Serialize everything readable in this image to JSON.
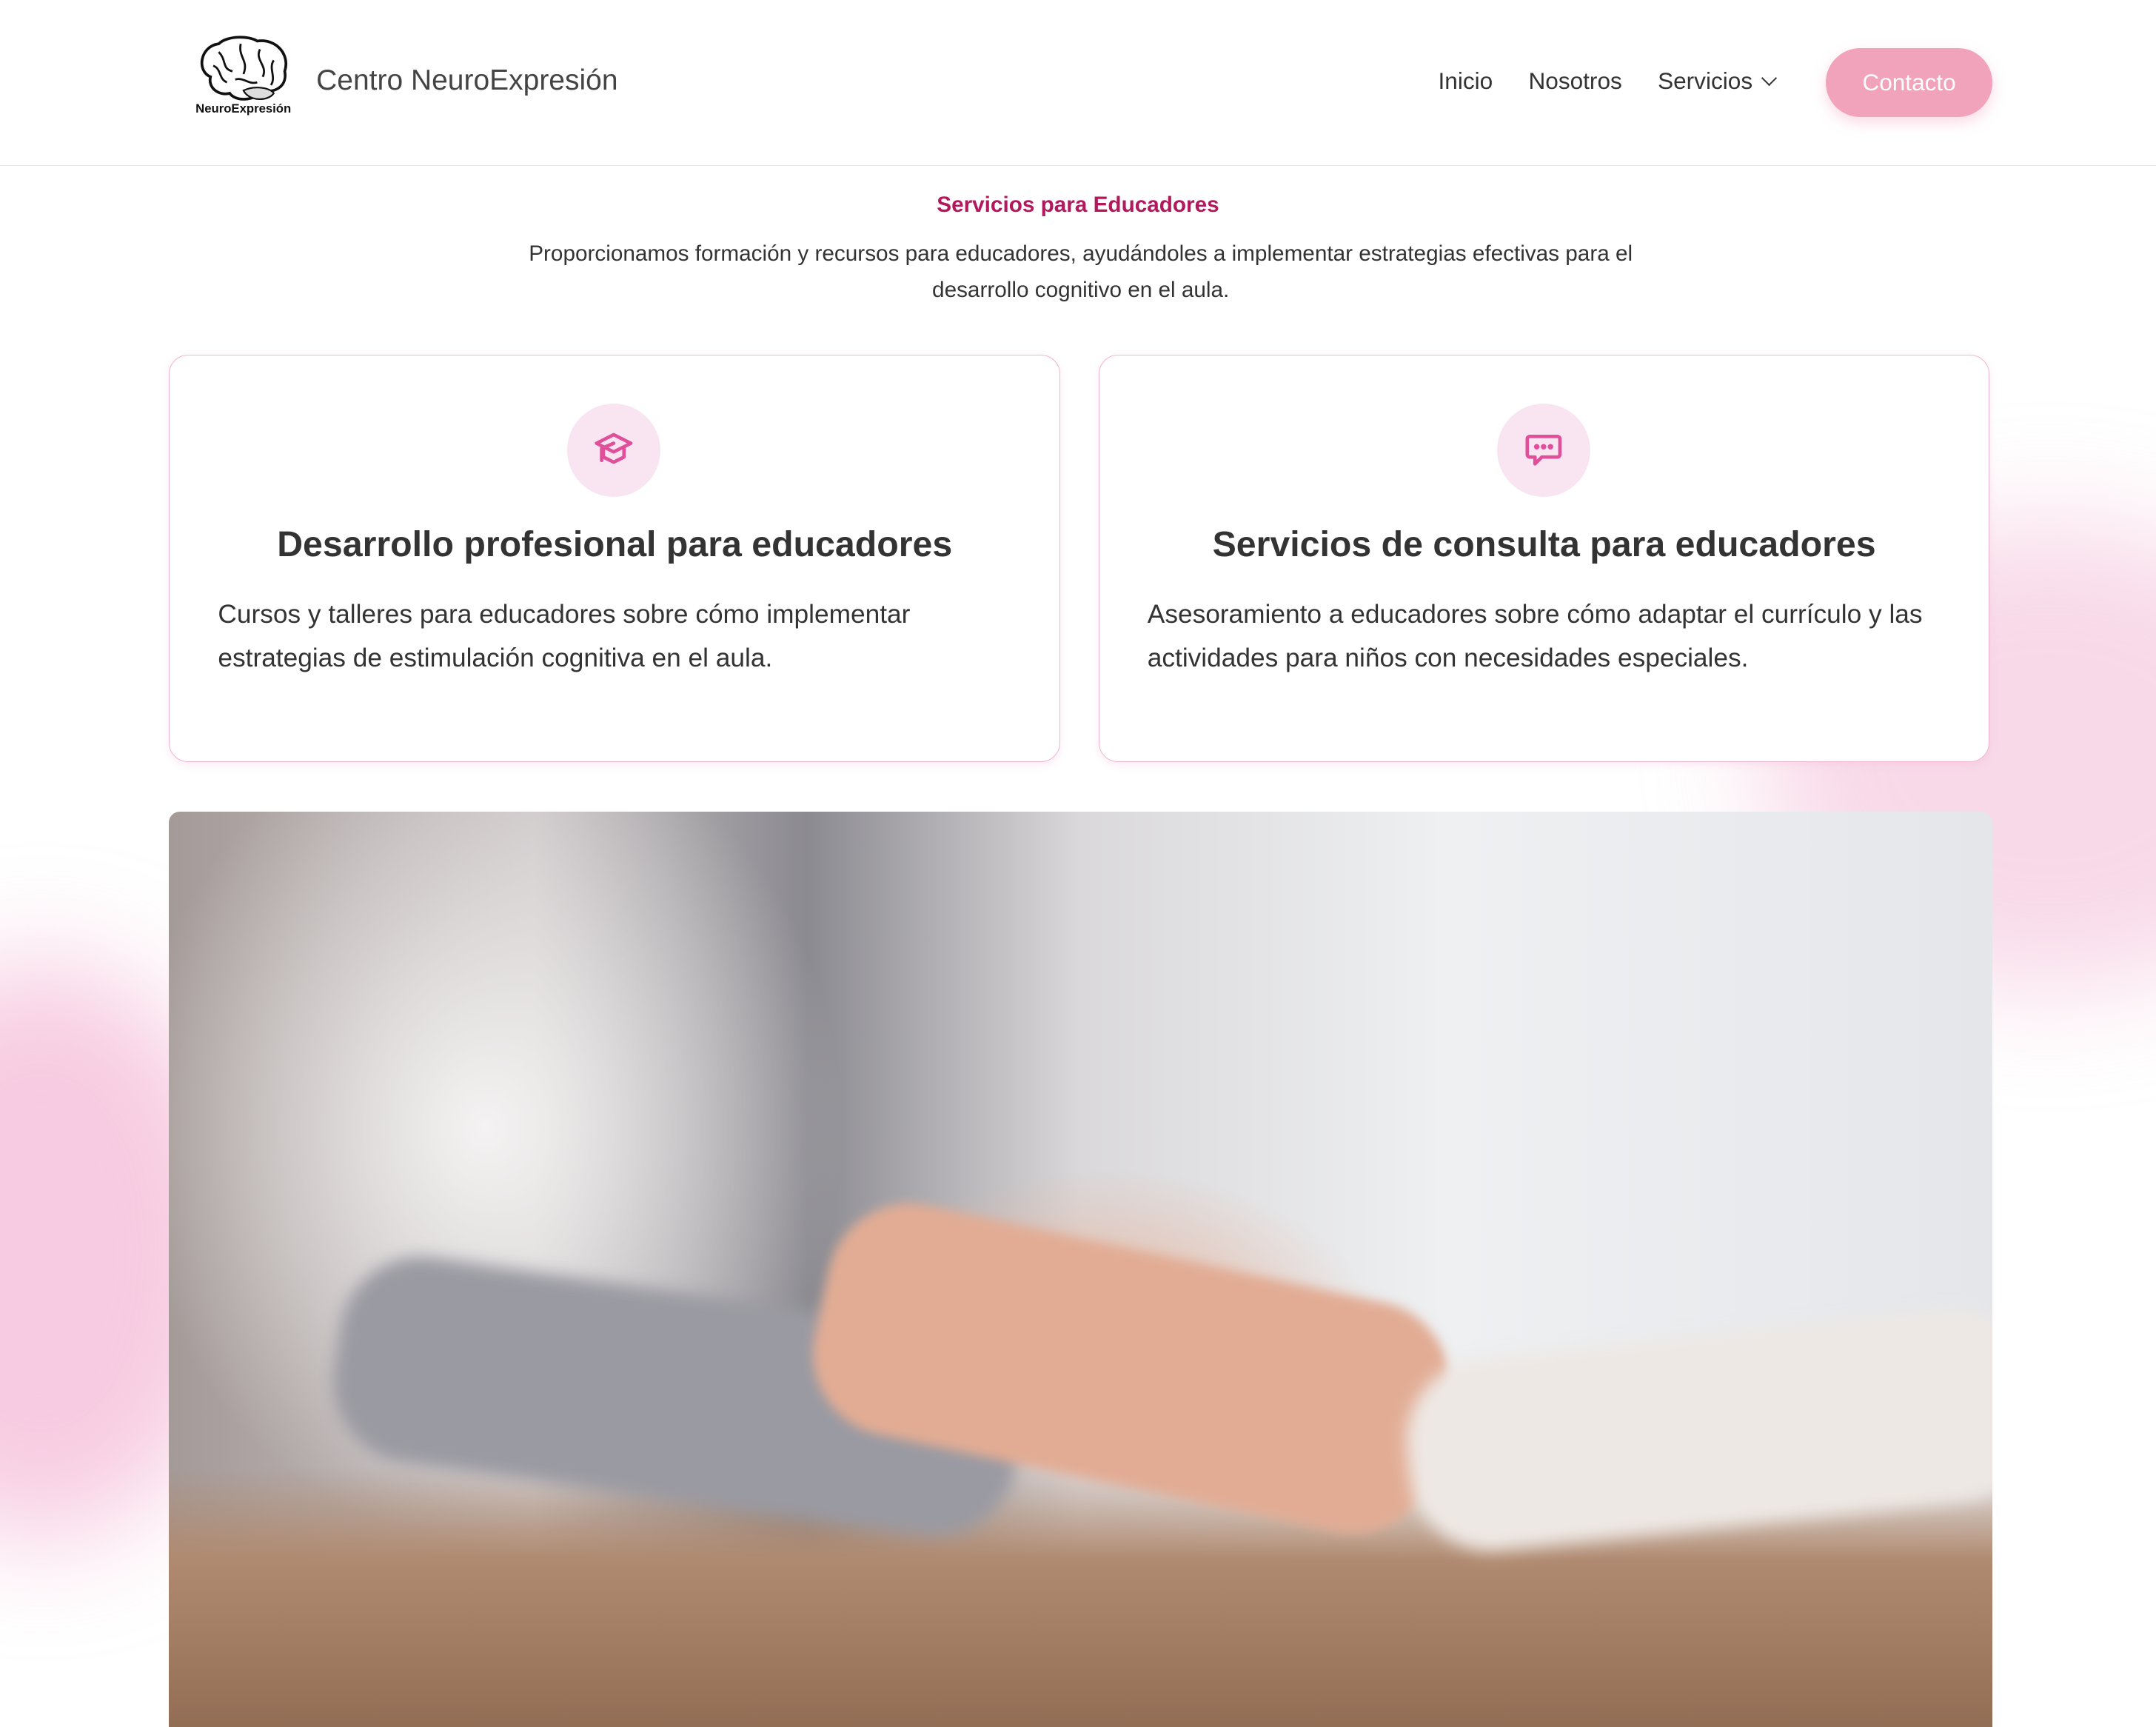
{
  "header": {
    "logo_text": "NeuroExpresión",
    "brand": "Centro NeuroExpresión",
    "nav": [
      "Inicio",
      "Nosotros",
      "Servicios"
    ],
    "cta": "Contacto"
  },
  "section": {
    "title": "Servicios para Educadores",
    "description": "Proporcionamos formación y recursos para educadores, ayudándoles a implementar estrategias efectivas para el desarrollo cognitivo en el aula."
  },
  "cards": [
    {
      "icon": "graduation-cap-icon",
      "title": "Desarrollo profesional para educadores",
      "text": "Cursos y talleres para educadores sobre cómo implementar estrategias de estimulación cognitiva en el aula."
    },
    {
      "icon": "chat-bubble-icon",
      "title": "Servicios de consulta para educadores",
      "text": "Asesoramiento a educadores sobre cómo adaptar el currículo y las actividades para niños con necesidades especiales."
    }
  ],
  "colors": {
    "accent": "#b3175c",
    "cta": "#f0a3ba",
    "icon": "#e0509a",
    "icon_bg": "#f9e4f1"
  }
}
